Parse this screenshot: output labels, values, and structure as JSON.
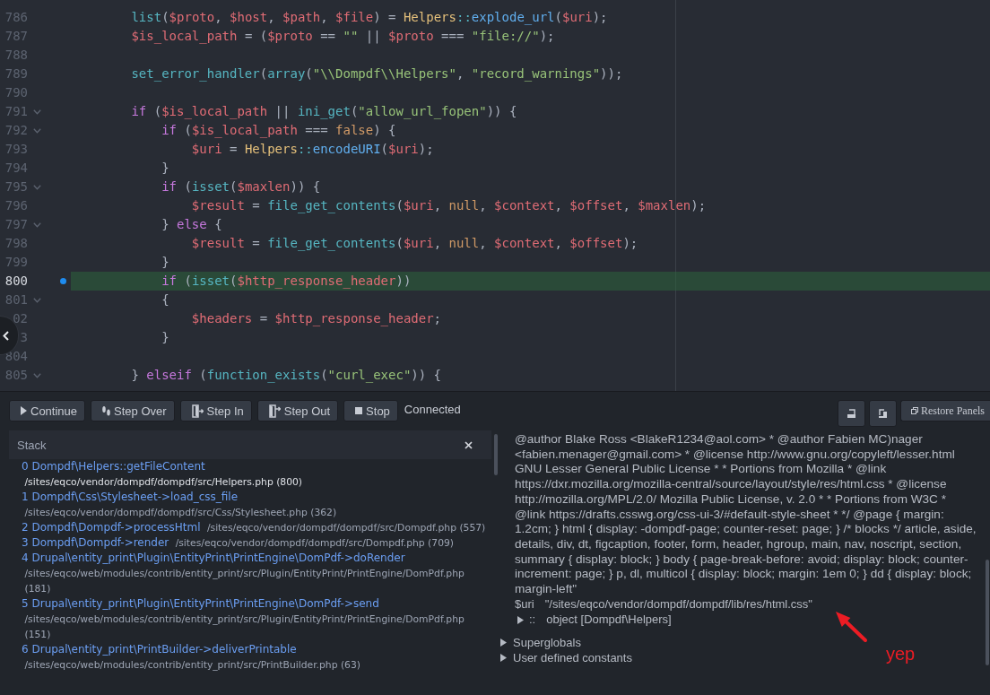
{
  "editor": {
    "lines": [
      {
        "number": "786",
        "foldable": false,
        "breakpoint": false,
        "current": false,
        "code": [
          {
            "text": "        list",
            "kind": "func"
          },
          {
            "text": "(",
            "kind": "punc"
          },
          {
            "text": "$proto",
            "kind": "var"
          },
          {
            "text": ", ",
            "kind": "punc"
          },
          {
            "text": "$host",
            "kind": "var"
          },
          {
            "text": ", ",
            "kind": "punc"
          },
          {
            "text": "$path",
            "kind": "var"
          },
          {
            "text": ", ",
            "kind": "punc"
          },
          {
            "text": "$file",
            "kind": "var"
          },
          {
            "text": ") = ",
            "kind": "punc"
          },
          {
            "text": "Helpers",
            "kind": "class"
          },
          {
            "text": "::",
            "kind": "scope"
          },
          {
            "text": "explode_url",
            "kind": "method"
          },
          {
            "text": "(",
            "kind": "punc"
          },
          {
            "text": "$uri",
            "kind": "var"
          },
          {
            "text": ");",
            "kind": "punc"
          }
        ]
      },
      {
        "number": "787",
        "foldable": false,
        "breakpoint": false,
        "current": false,
        "code": [
          {
            "text": "        $is_local_path",
            "kind": "var"
          },
          {
            "text": " = (",
            "kind": "punc"
          },
          {
            "text": "$proto",
            "kind": "var"
          },
          {
            "text": " == ",
            "kind": "punc"
          },
          {
            "text": "\"\"",
            "kind": "str"
          },
          {
            "text": " || ",
            "kind": "punc"
          },
          {
            "text": "$proto",
            "kind": "var"
          },
          {
            "text": " === ",
            "kind": "punc"
          },
          {
            "text": "\"file://\"",
            "kind": "str"
          },
          {
            "text": ");",
            "kind": "punc"
          }
        ]
      },
      {
        "number": "788",
        "foldable": false,
        "breakpoint": false,
        "current": false
      },
      {
        "number": "789",
        "foldable": false,
        "breakpoint": false,
        "current": false,
        "code": [
          {
            "text": "        set_error_handler",
            "kind": "func"
          },
          {
            "text": "(",
            "kind": "punc"
          },
          {
            "text": "array",
            "kind": "func"
          },
          {
            "text": "(",
            "kind": "punc"
          },
          {
            "text": "\"\\\\Dompdf\\\\Helpers\"",
            "kind": "str"
          },
          {
            "text": ", ",
            "kind": "punc"
          },
          {
            "text": "\"record_warnings\"",
            "kind": "str"
          },
          {
            "text": "));",
            "kind": "punc"
          }
        ]
      },
      {
        "number": "790",
        "foldable": false,
        "breakpoint": false,
        "current": false
      },
      {
        "number": "791",
        "foldable": true,
        "breakpoint": false,
        "current": false,
        "code": [
          {
            "text": "        if",
            "kind": "kw"
          },
          {
            "text": " (",
            "kind": "punc"
          },
          {
            "text": "$is_local_path",
            "kind": "var"
          },
          {
            "text": " || ",
            "kind": "punc"
          },
          {
            "text": "ini_get",
            "kind": "func"
          },
          {
            "text": "(",
            "kind": "punc"
          },
          {
            "text": "\"allow_url_fopen\"",
            "kind": "str"
          },
          {
            "text": ")) {",
            "kind": "punc"
          }
        ]
      },
      {
        "number": "792",
        "foldable": true,
        "breakpoint": false,
        "current": false,
        "code": [
          {
            "text": "            if",
            "kind": "kw"
          },
          {
            "text": " (",
            "kind": "punc"
          },
          {
            "text": "$is_local_path",
            "kind": "var"
          },
          {
            "text": " === ",
            "kind": "punc"
          },
          {
            "text": "false",
            "kind": "const"
          },
          {
            "text": ") {",
            "kind": "punc"
          }
        ]
      },
      {
        "number": "793",
        "foldable": false,
        "breakpoint": false,
        "current": false,
        "code": [
          {
            "text": "                $uri",
            "kind": "var"
          },
          {
            "text": " = ",
            "kind": "punc"
          },
          {
            "text": "Helpers",
            "kind": "class"
          },
          {
            "text": "::",
            "kind": "scope"
          },
          {
            "text": "encodeURI",
            "kind": "method"
          },
          {
            "text": "(",
            "kind": "punc"
          },
          {
            "text": "$uri",
            "kind": "var"
          },
          {
            "text": ");",
            "kind": "punc"
          }
        ]
      },
      {
        "number": "794",
        "foldable": false,
        "breakpoint": false,
        "current": false,
        "code": [
          {
            "text": "            }",
            "kind": "punc"
          }
        ]
      },
      {
        "number": "795",
        "foldable": true,
        "breakpoint": false,
        "current": false,
        "code": [
          {
            "text": "            if",
            "kind": "kw"
          },
          {
            "text": " (",
            "kind": "punc"
          },
          {
            "text": "isset",
            "kind": "func"
          },
          {
            "text": "(",
            "kind": "punc"
          },
          {
            "text": "$maxlen",
            "kind": "var"
          },
          {
            "text": ")) {",
            "kind": "punc"
          }
        ]
      },
      {
        "number": "796",
        "foldable": false,
        "breakpoint": false,
        "current": false,
        "code": [
          {
            "text": "                $result",
            "kind": "var"
          },
          {
            "text": " = ",
            "kind": "punc"
          },
          {
            "text": "file_get_contents",
            "kind": "func"
          },
          {
            "text": "(",
            "kind": "punc"
          },
          {
            "text": "$uri",
            "kind": "var"
          },
          {
            "text": ", ",
            "kind": "punc"
          },
          {
            "text": "null",
            "kind": "const"
          },
          {
            "text": ", ",
            "kind": "punc"
          },
          {
            "text": "$context",
            "kind": "var"
          },
          {
            "text": ", ",
            "kind": "punc"
          },
          {
            "text": "$offset",
            "kind": "var"
          },
          {
            "text": ", ",
            "kind": "punc"
          },
          {
            "text": "$maxlen",
            "kind": "var"
          },
          {
            "text": ");",
            "kind": "punc"
          }
        ]
      },
      {
        "number": "797",
        "foldable": true,
        "breakpoint": false,
        "current": false,
        "code": [
          {
            "text": "            } ",
            "kind": "punc"
          },
          {
            "text": "else",
            "kind": "kw"
          },
          {
            "text": " {",
            "kind": "punc"
          }
        ]
      },
      {
        "number": "798",
        "foldable": false,
        "breakpoint": false,
        "current": false,
        "code": [
          {
            "text": "                $result",
            "kind": "var"
          },
          {
            "text": " = ",
            "kind": "punc"
          },
          {
            "text": "file_get_contents",
            "kind": "func"
          },
          {
            "text": "(",
            "kind": "punc"
          },
          {
            "text": "$uri",
            "kind": "var"
          },
          {
            "text": ", ",
            "kind": "punc"
          },
          {
            "text": "null",
            "kind": "const"
          },
          {
            "text": ", ",
            "kind": "punc"
          },
          {
            "text": "$context",
            "kind": "var"
          },
          {
            "text": ", ",
            "kind": "punc"
          },
          {
            "text": "$offset",
            "kind": "var"
          },
          {
            "text": ");",
            "kind": "punc"
          }
        ]
      },
      {
        "number": "799",
        "foldable": false,
        "breakpoint": false,
        "current": false,
        "code": [
          {
            "text": "            }",
            "kind": "punc"
          }
        ]
      },
      {
        "number": "800",
        "foldable": false,
        "breakpoint": true,
        "current": true,
        "code": [
          {
            "text": "            if",
            "kind": "kw"
          },
          {
            "text": " (",
            "kind": "punc"
          },
          {
            "text": "isset",
            "kind": "func"
          },
          {
            "text": "(",
            "kind": "punc"
          },
          {
            "text": "$http_response_header",
            "kind": "var"
          },
          {
            "text": "))",
            "kind": "punc"
          }
        ]
      },
      {
        "number": "801",
        "foldable": true,
        "breakpoint": false,
        "current": false,
        "code": [
          {
            "text": "            {",
            "kind": "punc"
          }
        ]
      },
      {
        "number": "02",
        "foldable": false,
        "breakpoint": false,
        "current": false,
        "code": [
          {
            "text": "                $headers",
            "kind": "var"
          },
          {
            "text": " = ",
            "kind": "punc"
          },
          {
            "text": "$http_response_header",
            "kind": "var"
          },
          {
            "text": ";",
            "kind": "punc"
          }
        ]
      },
      {
        "number": "3",
        "foldable": false,
        "breakpoint": false,
        "current": false,
        "code": [
          {
            "text": "            }",
            "kind": "punc"
          }
        ]
      },
      {
        "number": "804",
        "foldable": false,
        "breakpoint": false,
        "current": false
      },
      {
        "number": "805",
        "foldable": true,
        "breakpoint": false,
        "current": false,
        "code": [
          {
            "text": "        } ",
            "kind": "punc"
          },
          {
            "text": "elseif",
            "kind": "kw"
          },
          {
            "text": " (",
            "kind": "punc"
          },
          {
            "text": "function_exists",
            "kind": "func"
          },
          {
            "text": "(",
            "kind": "punc"
          },
          {
            "text": "\"curl_exec\"",
            "kind": "str"
          },
          {
            "text": ")) {",
            "kind": "punc"
          }
        ]
      }
    ]
  },
  "toolbar": {
    "buttons": [
      {
        "label": "Continue",
        "kind": "continue"
      },
      {
        "label": "Step Over",
        "kind": "step-over"
      },
      {
        "label": "Step In",
        "kind": "step-in"
      },
      {
        "label": "Step Out",
        "kind": "step-out"
      },
      {
        "label": "Stop",
        "kind": "stop"
      }
    ],
    "status": "Connected",
    "layout_buttons": [
      {
        "kind": "dock-bottom"
      },
      {
        "kind": "dock-right"
      }
    ],
    "restore_button": {
      "label": "Restore Panels"
    }
  },
  "stack": {
    "title": "Stack",
    "frames": [
      {
        "index": "0",
        "function": "Dompdf\\Helpers::getFileContent",
        "file": "/sites/eqco/vendor/dompdf/dompdf/src/Helpers.php",
        "line": "(800)",
        "selected": true
      },
      {
        "index": "1",
        "function": "Dompdf\\Css\\Stylesheet->load_css_file",
        "file": "/sites/eqco/vendor/dompdf/dompdf/src/Css/Stylesheet.php",
        "line": "(362)",
        "selected": false
      },
      {
        "index": "2",
        "function": "Dompdf\\Dompdf->processHtml",
        "file": "/sites/eqco/vendor/dompdf/dompdf/src/Dompdf.php",
        "line": "(557)",
        "selected": false
      },
      {
        "index": "3",
        "function": "Dompdf\\Dompdf->render",
        "file": "/sites/eqco/vendor/dompdf/dompdf/src/Dompdf.php",
        "line": "(709)",
        "selected": false
      },
      {
        "index": "4",
        "function": "Drupal\\entity_print\\Plugin\\EntityPrint\\PrintEngine\\DomPdf->doRender",
        "file": "/sites/eqco/web/modules/contrib/entity_print/src/Plugin/EntityPrint/PrintEngine/DomPdf.php",
        "line": "(181)",
        "selected": false
      },
      {
        "index": "5",
        "function": "Drupal\\entity_print\\Plugin\\EntityPrint\\PrintEngine\\DomPdf->send",
        "file": "/sites/eqco/web/modules/contrib/entity_print/src/Plugin/EntityPrint/PrintEngine/DomPdf.php",
        "line": "(151)",
        "selected": false
      },
      {
        "index": "6",
        "function": "Drupal\\entity_print\\PrintBuilder->deliverPrintable",
        "file": "/sites/eqco/web/modules/contrib/entity_print/src/PrintBuilder.php",
        "line": "(63)",
        "selected": false
      }
    ]
  },
  "variables": {
    "value_text": "@author Blake Ross <BlakeR1234@aol.com> * @author Fabien MC)nager <fabien.menager@gmail.com> * @license http://www.gnu.org/copyleft/lesser.html GNU Lesser General Public License * * Portions from Mozilla * @link https://dxr.mozilla.org/mozilla-central/source/layout/style/res/html.css * @license http://mozilla.org/MPL/2.0/ Mozilla Public License, v. 2.0 * * Portions from W3C * @link https://drafts.csswg.org/css-ui-3/#default-style-sheet * */ @page { margin: 1.2cm; } html { display: -dompdf-page; counter-reset: page; } /* blocks */ article, aside, details, div, dt, figcaption, footer, form, header, hgroup, main, nav, noscript, section, summary { display: block; } body { page-break-before: avoid; display: block; counter-increment: page; } p, dl, multicol { display: block; margin: 1em 0; } dd { display: block; margin-left\"",
    "rows": [
      {
        "kind": "scalar",
        "name": "$uri",
        "value": "\"/sites/eqco/vendor/dompdf/dompdf/lib/res/html.css\""
      },
      {
        "kind": "object",
        "name": "::",
        "value": "object [Dompdf\\Helpers]",
        "expanded": false
      }
    ],
    "sections": [
      {
        "label": "Superglobals",
        "expanded": false
      },
      {
        "label": "User defined constants",
        "expanded": false
      }
    ]
  },
  "annotation": {
    "text": "yep"
  }
}
